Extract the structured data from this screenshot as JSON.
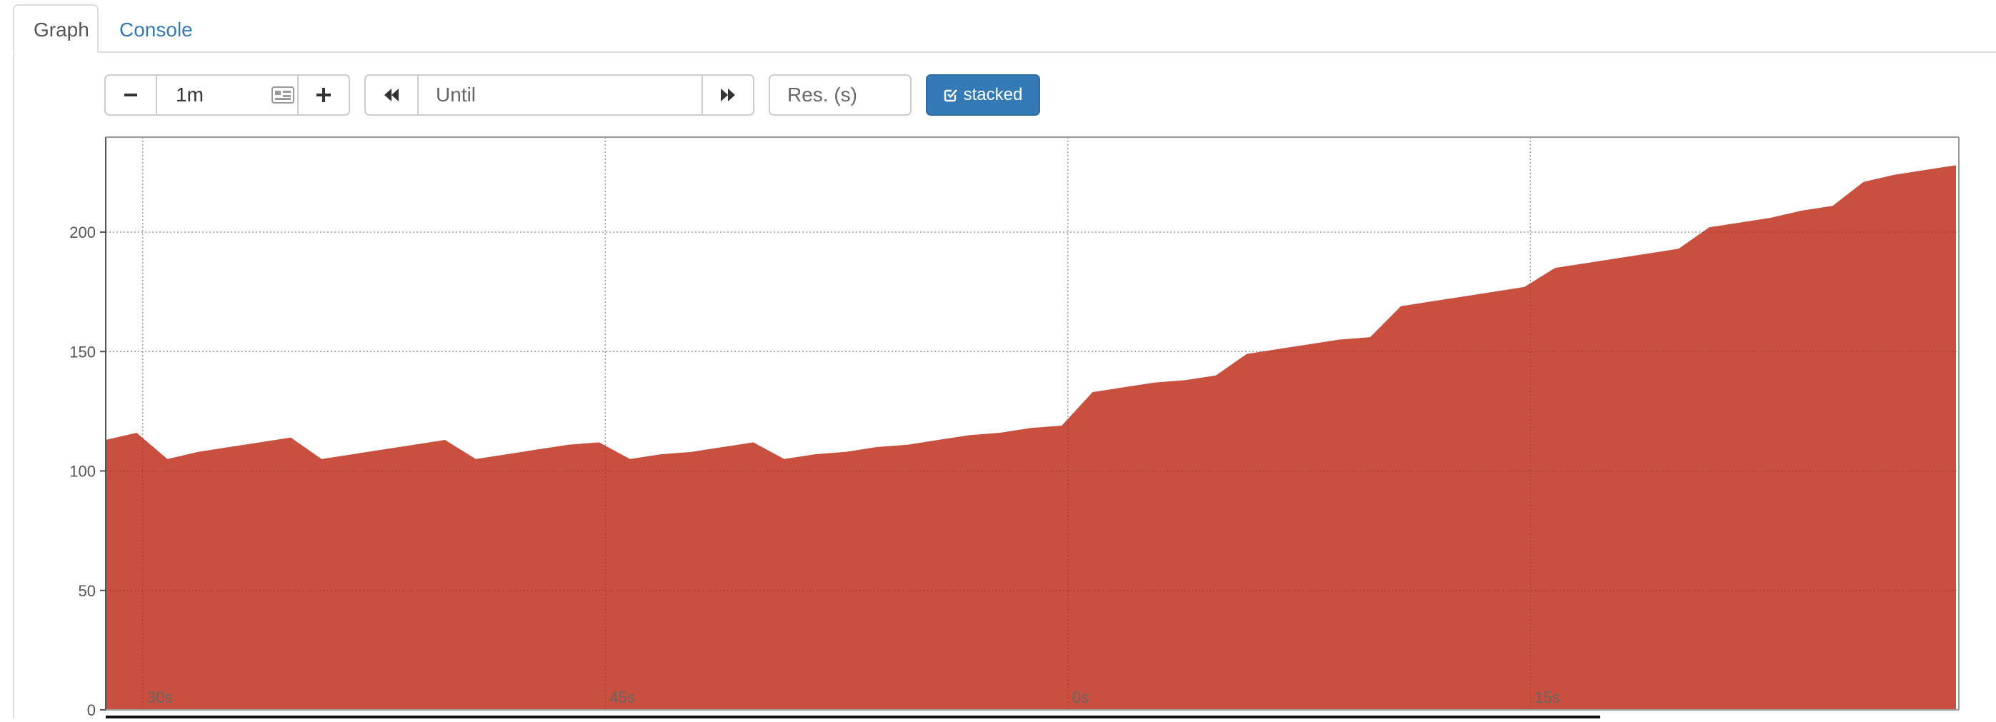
{
  "tabs": [
    {
      "label": "Graph",
      "active": true
    },
    {
      "label": "Console",
      "active": false
    }
  ],
  "controls": {
    "range_minus_icon": "minus-icon",
    "range_value": "1m",
    "range_picker_icon": "range-input-icon",
    "range_plus_icon": "plus-icon",
    "end_back_icon": "backward-icon",
    "end_placeholder": "Until",
    "end_forward_icon": "forward-icon",
    "resolution_placeholder": "Res. (s)",
    "stacked_label": "stacked",
    "stacked_icon": "check-square-icon",
    "stacked_active": true
  },
  "colors": {
    "series_fill": "#c9503e",
    "accent": "#337ab7",
    "tab_link": "#337ab7",
    "grid": "#bbbbbb"
  },
  "chart_data": {
    "type": "area",
    "stacked": true,
    "grid": true,
    "ylim": [
      0,
      240
    ],
    "y_ticks": [
      0,
      50,
      100,
      150,
      200
    ],
    "x_tick_labels": [
      "30s",
      "45s",
      "0s",
      "15s"
    ],
    "x_tick_seconds": [
      1.2,
      16.2,
      31.2,
      46.2
    ],
    "xlim_seconds": [
      0,
      60
    ],
    "series": [
      {
        "x": [
          0,
          1,
          2,
          3,
          4,
          5,
          6,
          7,
          8,
          9,
          10,
          11,
          12,
          13,
          14,
          15,
          16,
          17,
          18,
          19,
          20,
          21,
          22,
          23,
          24,
          25,
          26,
          27,
          28,
          29,
          30,
          31,
          32,
          33,
          34,
          35,
          36,
          37,
          38,
          39,
          40,
          41,
          42,
          43,
          44,
          45,
          46,
          47,
          48,
          49,
          50,
          51,
          52,
          53,
          54,
          55,
          56,
          57,
          58,
          59,
          60
        ],
        "values": [
          113,
          116,
          105,
          108,
          110,
          112,
          114,
          105,
          107,
          109,
          111,
          113,
          105,
          107,
          109,
          111,
          112,
          105,
          107,
          108,
          110,
          112,
          105,
          107,
          108,
          110,
          111,
          113,
          115,
          116,
          118,
          119,
          133,
          135,
          137,
          138,
          140,
          149,
          151,
          153,
          155,
          156,
          169,
          171,
          173,
          175,
          177,
          185,
          187,
          189,
          191,
          193,
          202,
          204,
          206,
          209,
          211,
          221,
          224,
          226,
          228
        ]
      }
    ]
  }
}
